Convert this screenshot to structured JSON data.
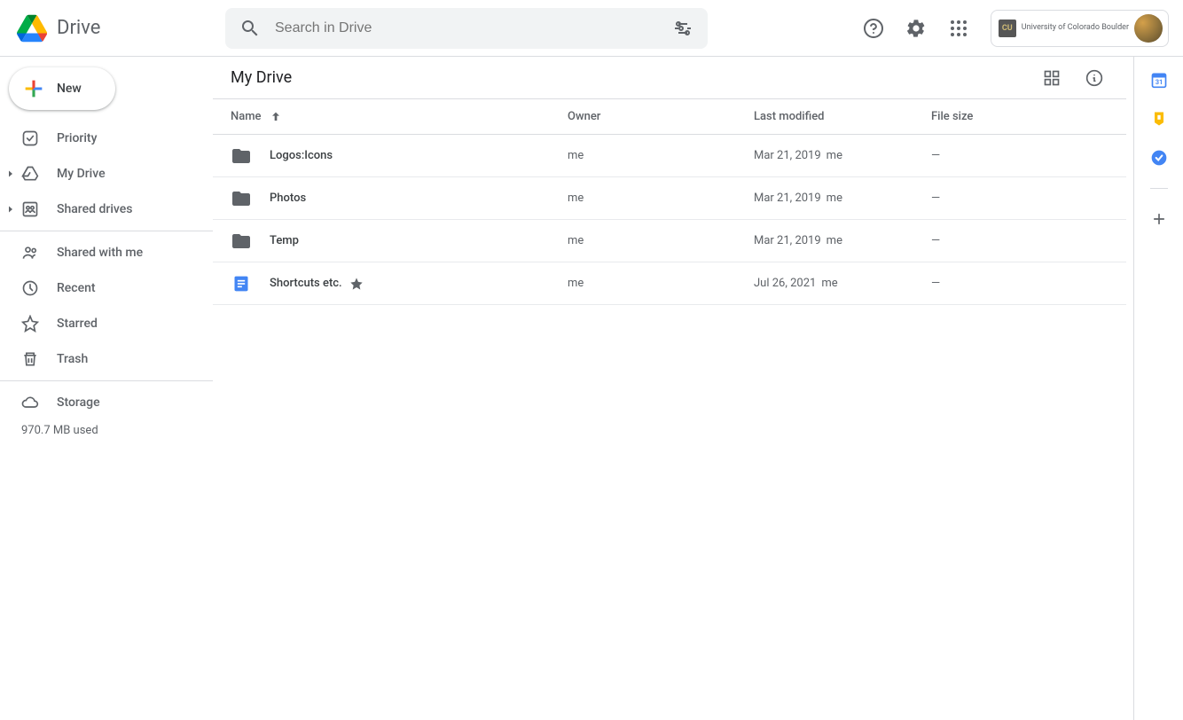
{
  "header": {
    "product_name": "Drive",
    "search_placeholder": "Search in Drive",
    "org_name": "University of Colorado Boulder"
  },
  "sidebar": {
    "new_label": "New",
    "items": [
      {
        "label": "Priority",
        "icon": "priority"
      },
      {
        "label": "My Drive",
        "icon": "mydrive",
        "expandable": true
      },
      {
        "label": "Shared drives",
        "icon": "shareddrives",
        "expandable": true
      }
    ],
    "items2": [
      {
        "label": "Shared with me",
        "icon": "shared"
      },
      {
        "label": "Recent",
        "icon": "recent"
      },
      {
        "label": "Starred",
        "icon": "starred"
      },
      {
        "label": "Trash",
        "icon": "trash"
      }
    ],
    "storage_label": "Storage",
    "storage_used": "970.7 MB used"
  },
  "content": {
    "breadcrumb": "My Drive",
    "columns": {
      "name": "Name",
      "owner": "Owner",
      "modified": "Last modified",
      "size": "File size"
    },
    "rows": [
      {
        "type": "folder",
        "name": "Logos:Icons",
        "owner": "me",
        "modified": "Mar 21, 2019",
        "modified_by": "me",
        "size": "—",
        "starred": false
      },
      {
        "type": "folder",
        "name": "Photos",
        "owner": "me",
        "modified": "Mar 21, 2019",
        "modified_by": "me",
        "size": "—",
        "starred": false
      },
      {
        "type": "folder",
        "name": "Temp",
        "owner": "me",
        "modified": "Mar 21, 2019",
        "modified_by": "me",
        "size": "—",
        "starred": false
      },
      {
        "type": "doc",
        "name": "Shortcuts etc.",
        "owner": "me",
        "modified": "Jul 26, 2021",
        "modified_by": "me",
        "size": "—",
        "starred": true
      }
    ]
  }
}
